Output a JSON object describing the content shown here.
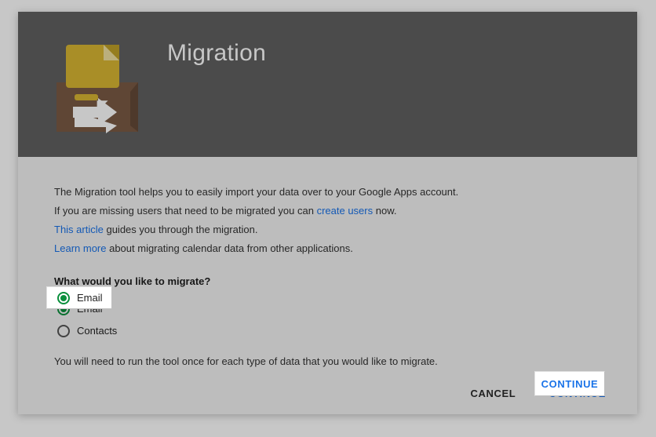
{
  "header": {
    "title": "Migration"
  },
  "body": {
    "intro": "The Migration tool helps you to easily import your data over to your Google Apps account.",
    "missing_prefix": "If you are missing users that need to be migrated you can ",
    "create_users_link": "create users",
    "missing_suffix": " now.",
    "article_link": "This article",
    "article_suffix": " guides you through the migration.",
    "learn_link": "Learn more",
    "learn_suffix": " about migrating calendar data from other applications.",
    "question": "What would you like to migrate?",
    "options": {
      "email": "Email",
      "contacts": "Contacts"
    },
    "note": "You will need to run the tool once for each type of data that you would like to migrate."
  },
  "actions": {
    "cancel": "CANCEL",
    "continue": "CONTINUE"
  }
}
